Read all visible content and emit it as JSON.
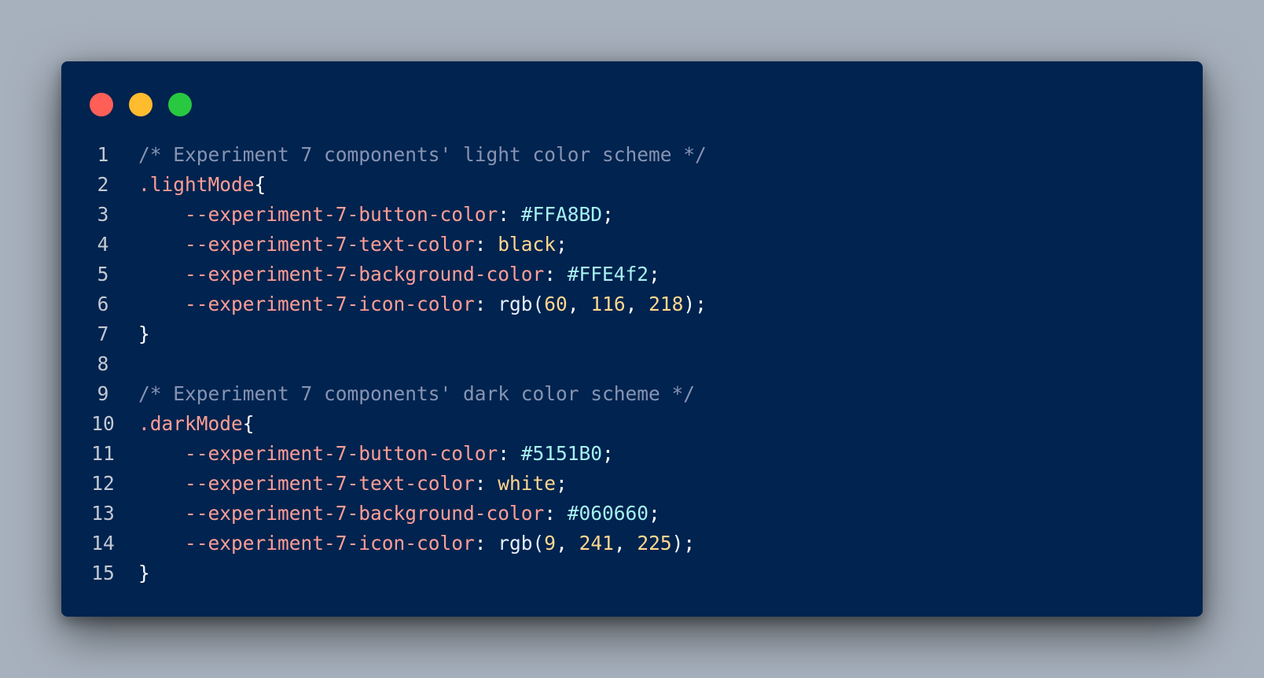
{
  "window": {
    "traffic_lights": [
      {
        "name": "close",
        "color": "#ff5f57"
      },
      {
        "name": "minimize",
        "color": "#febc2e"
      },
      {
        "name": "zoom",
        "color": "#28c840"
      }
    ]
  },
  "code": {
    "lines": [
      {
        "num": "1",
        "tokens": [
          {
            "t": "/* Experiment 7 components' light color scheme */",
            "c": "comment"
          }
        ]
      },
      {
        "num": "2",
        "tokens": [
          {
            "t": ".lightMode",
            "c": "selector"
          },
          {
            "t": "{",
            "c": "punct"
          }
        ]
      },
      {
        "num": "3",
        "tokens": [
          {
            "t": "    --experiment-7-button-color",
            "c": "prop"
          },
          {
            "t": ": ",
            "c": "punct"
          },
          {
            "t": "#FFA8BD",
            "c": "hex"
          },
          {
            "t": ";",
            "c": "punct"
          }
        ]
      },
      {
        "num": "4",
        "tokens": [
          {
            "t": "    --experiment-7-text-color",
            "c": "prop"
          },
          {
            "t": ": ",
            "c": "punct"
          },
          {
            "t": "black",
            "c": "keyword"
          },
          {
            "t": ";",
            "c": "punct"
          }
        ]
      },
      {
        "num": "5",
        "tokens": [
          {
            "t": "    --experiment-7-background-color",
            "c": "prop"
          },
          {
            "t": ": ",
            "c": "punct"
          },
          {
            "t": "#FFE4f2",
            "c": "hex"
          },
          {
            "t": ";",
            "c": "punct"
          }
        ]
      },
      {
        "num": "6",
        "tokens": [
          {
            "t": "    --experiment-7-icon-color",
            "c": "prop"
          },
          {
            "t": ": ",
            "c": "punct"
          },
          {
            "t": "rgb(",
            "c": "func"
          },
          {
            "t": "60",
            "c": "num"
          },
          {
            "t": ", ",
            "c": "punct"
          },
          {
            "t": "116",
            "c": "num"
          },
          {
            "t": ", ",
            "c": "punct"
          },
          {
            "t": "218",
            "c": "num"
          },
          {
            "t": ");",
            "c": "punct"
          }
        ]
      },
      {
        "num": "7",
        "tokens": [
          {
            "t": "}",
            "c": "punct"
          }
        ]
      },
      {
        "num": "8",
        "tokens": []
      },
      {
        "num": "9",
        "tokens": [
          {
            "t": "/* Experiment 7 components' dark color scheme */",
            "c": "comment"
          }
        ]
      },
      {
        "num": "10",
        "tokens": [
          {
            "t": ".darkMode",
            "c": "selector"
          },
          {
            "t": "{",
            "c": "punct"
          }
        ]
      },
      {
        "num": "11",
        "tokens": [
          {
            "t": "    --experiment-7-button-color",
            "c": "prop"
          },
          {
            "t": ": ",
            "c": "punct"
          },
          {
            "t": "#5151B0",
            "c": "hex"
          },
          {
            "t": ";",
            "c": "punct"
          }
        ]
      },
      {
        "num": "12",
        "tokens": [
          {
            "t": "    --experiment-7-text-color",
            "c": "prop"
          },
          {
            "t": ": ",
            "c": "punct"
          },
          {
            "t": "white",
            "c": "keyword"
          },
          {
            "t": ";",
            "c": "punct"
          }
        ]
      },
      {
        "num": "13",
        "tokens": [
          {
            "t": "    --experiment-7-background-color",
            "c": "prop"
          },
          {
            "t": ": ",
            "c": "punct"
          },
          {
            "t": "#060660",
            "c": "hex"
          },
          {
            "t": ";",
            "c": "punct"
          }
        ]
      },
      {
        "num": "14",
        "tokens": [
          {
            "t": "    --experiment-7-icon-color",
            "c": "prop"
          },
          {
            "t": ": ",
            "c": "punct"
          },
          {
            "t": "rgb(",
            "c": "func"
          },
          {
            "t": "9",
            "c": "num"
          },
          {
            "t": ", ",
            "c": "punct"
          },
          {
            "t": "241",
            "c": "num"
          },
          {
            "t": ", ",
            "c": "punct"
          },
          {
            "t": "225",
            "c": "num"
          },
          {
            "t": ");",
            "c": "punct"
          }
        ]
      },
      {
        "num": "15",
        "tokens": [
          {
            "t": "}",
            "c": "punct"
          }
        ]
      }
    ]
  }
}
